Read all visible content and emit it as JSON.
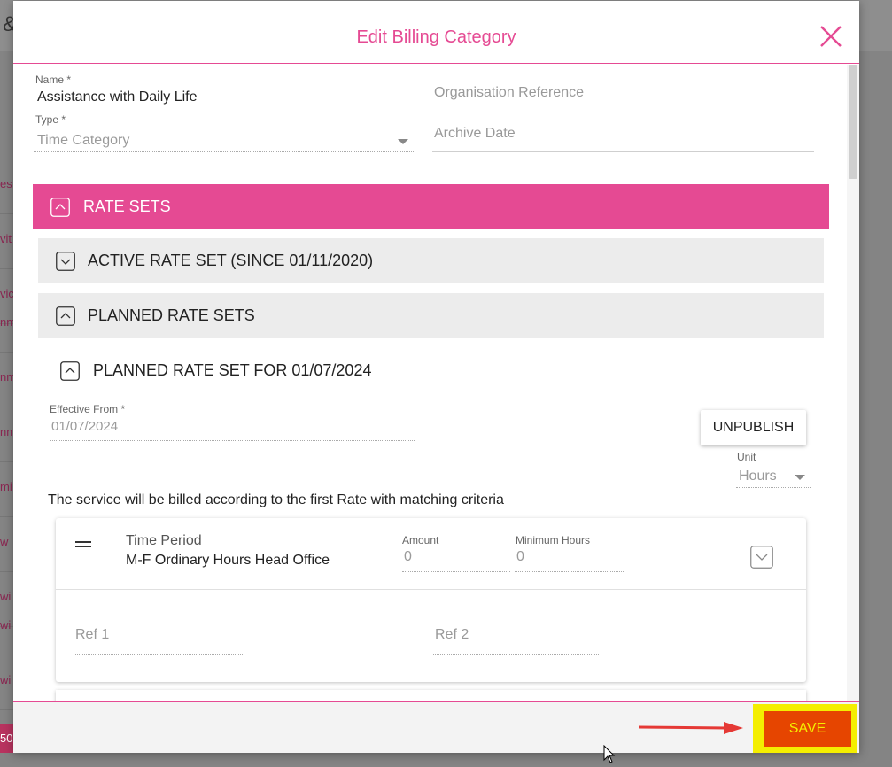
{
  "background": {
    "header_fragment": "&",
    "row_fragments": [
      "es",
      "vit",
      "vic",
      "nm",
      "nm",
      "nm",
      "mi",
      "w",
      "wi",
      "wi",
      "wi"
    ],
    "badge_fragment": "50"
  },
  "modal": {
    "title": "Edit Billing Category",
    "close_icon": "close-icon",
    "accent_color": "#e54a93"
  },
  "form": {
    "name": {
      "label": "Name *",
      "value": "Assistance with Daily Life"
    },
    "organisation_reference": {
      "placeholder": "Organisation Reference"
    },
    "type": {
      "label": "Type *",
      "value": "Time Category"
    },
    "archive_date": {
      "placeholder": "Archive Date"
    }
  },
  "rate_sets": {
    "title": "RATE SETS",
    "active": {
      "label": "ACTIVE RATE SET (SINCE 01/11/2020)"
    },
    "planned": {
      "label": "PLANNED RATE SETS"
    },
    "planned_item": {
      "label": "PLANNED RATE SET FOR 01/07/2024",
      "effective_from_label": "Effective From *",
      "effective_from_value": "01/07/2024",
      "unpublish_label": "UNPUBLISH",
      "unit_label": "Unit",
      "unit_value": "Hours",
      "info_text": "The service will be billed according to the first Rate with matching criteria",
      "rate": {
        "type": "Time Period",
        "name": "M-F Ordinary Hours Head Office",
        "amount_label": "Amount",
        "amount_value": "0",
        "minimum_hours_label": "Minimum Hours",
        "minimum_hours_value": "0",
        "ref1_placeholder": "Ref 1",
        "ref2_placeholder": "Ref 2"
      }
    }
  },
  "footer": {
    "save_label": "SAVE",
    "save_color": "#e64500",
    "highlight_color": "#f4ee00",
    "arrow_color": "#e53935"
  }
}
